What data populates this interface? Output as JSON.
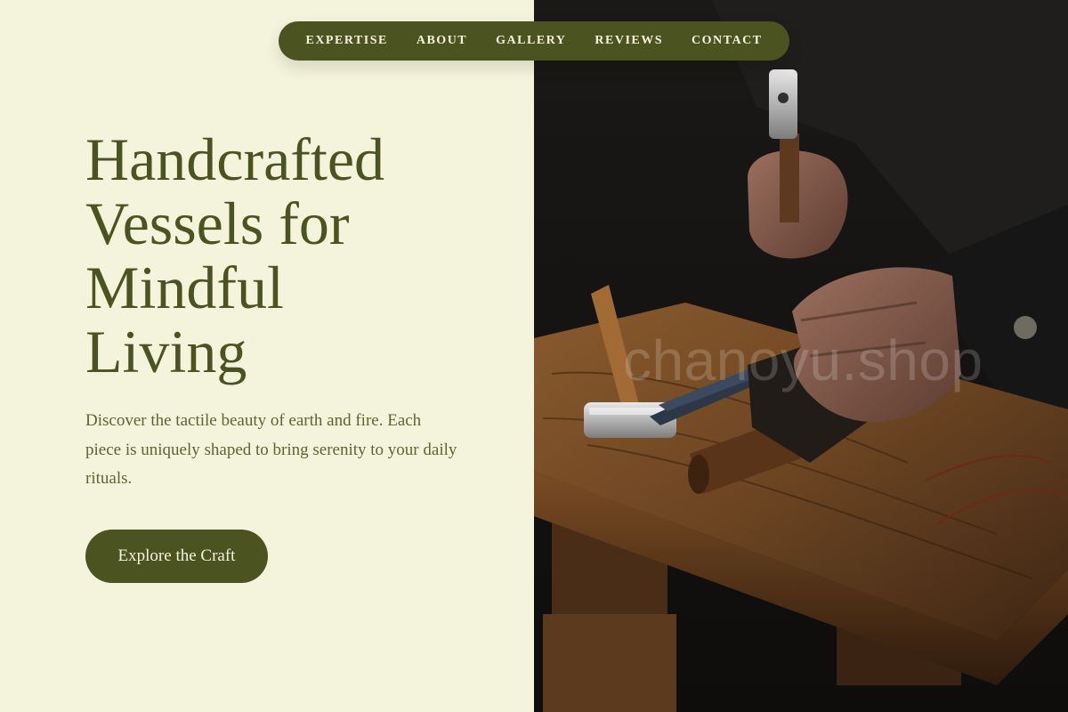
{
  "nav": {
    "items": [
      {
        "label": "EXPERTISE"
      },
      {
        "label": "ABOUT"
      },
      {
        "label": "GALLERY"
      },
      {
        "label": "REVIEWS"
      },
      {
        "label": "CONTACT"
      }
    ]
  },
  "hero": {
    "title": "Handcrafted Vessels for Mindful Living",
    "description": "Discover the tactile beauty of earth and fire. Each piece is uniquely shaped to bring serenity to your daily rituals.",
    "cta_label": "Explore the Craft"
  },
  "image": {
    "watermark": "chanoyu.shop"
  },
  "colors": {
    "background": "#f4f4dc",
    "accent": "#4b5320",
    "nav_text": "#f6f3dd",
    "body_text": "#5f6334"
  }
}
